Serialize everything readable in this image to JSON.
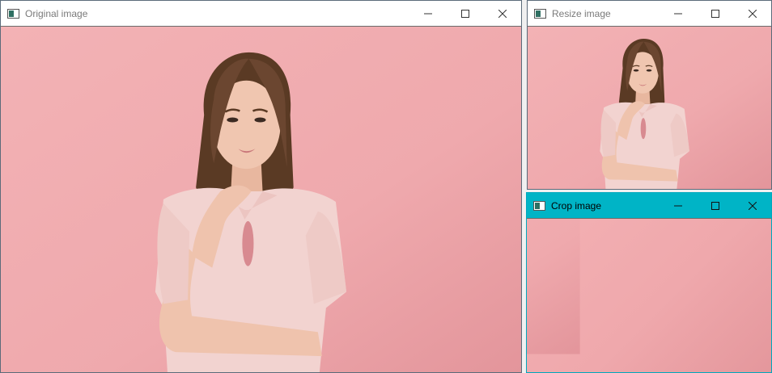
{
  "windows": {
    "original": {
      "title": "Original image"
    },
    "resize": {
      "title": "Resize image"
    },
    "crop": {
      "title": "Crop image"
    }
  },
  "icons": {
    "app": "image-window-icon",
    "minimize": "minimize-icon",
    "maximize": "maximize-icon",
    "close": "close-icon"
  },
  "colors": {
    "active_titlebar": "#00b4c6",
    "inactive_titlebar": "#ffffff",
    "photo_background": "#f1aeb1",
    "blouse": "#f2d3d0",
    "hair": "#5a3a24"
  }
}
